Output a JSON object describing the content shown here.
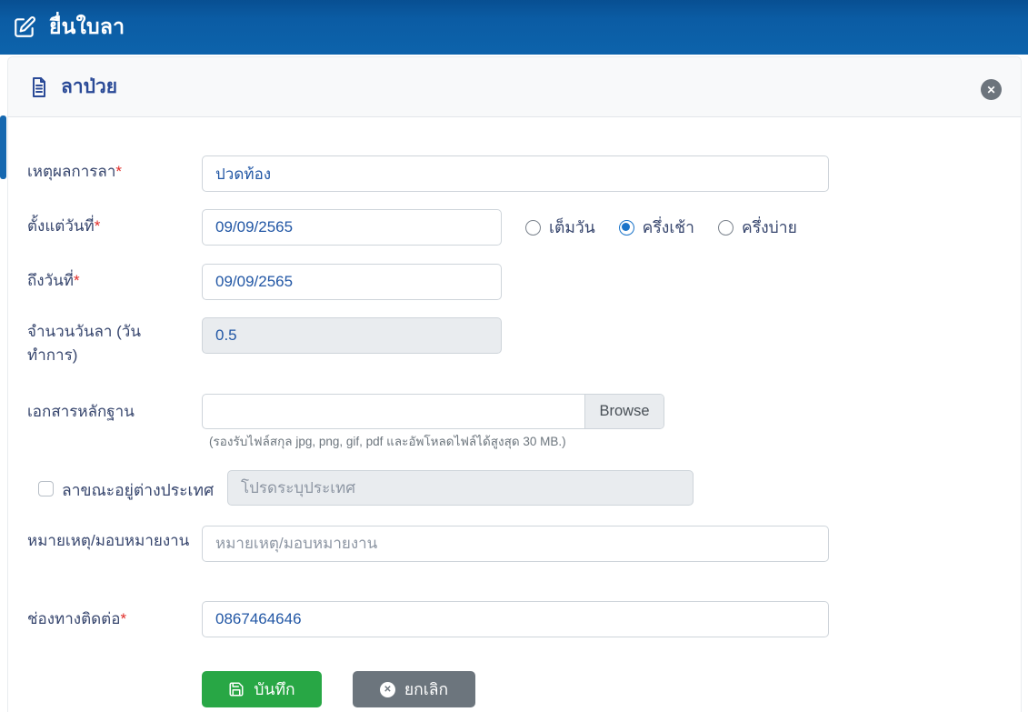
{
  "required_mark": "*",
  "titlebar": {
    "title": "ยื่นใบลา"
  },
  "panel": {
    "title": "ลาป่วย"
  },
  "form": {
    "reason": {
      "label": "เหตุผลการลา",
      "value": "ปวดท้อง"
    },
    "from_date": {
      "label": "ตั้งแต่วันที่",
      "value": "09/09/2565"
    },
    "day_options": [
      {
        "label": "เต็มวัน",
        "selected": false
      },
      {
        "label": "ครึ่งเช้า",
        "selected": true
      },
      {
        "label": "ครึ่งบ่าย",
        "selected": false
      }
    ],
    "to_date": {
      "label": "ถึงวันที่",
      "value": "09/09/2565"
    },
    "days_count": {
      "label": "จำนวนวันลา (วันทำการ)",
      "value": "0.5",
      "disabled": true
    },
    "attachment": {
      "label": "เอกสารหลักฐาน",
      "value": "",
      "browse_label": "Browse",
      "hint": "(รองรับไฟล์สกุล jpg, png, gif, pdf และอัพโหลดไฟล์ได้สูงสุด 30 MB.)"
    },
    "abroad": {
      "label": "ลาขณะอยู่ต่างประเทศ",
      "checked": false,
      "country_placeholder": "โปรดระบุประเทศ",
      "country_disabled": true
    },
    "note": {
      "label": "หมายเหตุ/มอบหมายงาน",
      "placeholder": "หมายเหตุ/มอบหมายงาน",
      "value": ""
    },
    "contact": {
      "label": "ช่องทางติดต่อ",
      "value": "0867464646"
    },
    "save_label": "บันทึก",
    "cancel_label": "ยกเลิก"
  },
  "colors": {
    "topbar_blue": "#0b5ca4",
    "panel_title_blue": "#2a4a97",
    "label_navy": "#36456d",
    "value_blue": "#2257a5",
    "radio_blue": "#1a73c9",
    "save_green": "#28a745",
    "cancel_gray": "#6c757d",
    "required_red": "#e02b27",
    "disabled_bg": "#e9ecef"
  }
}
